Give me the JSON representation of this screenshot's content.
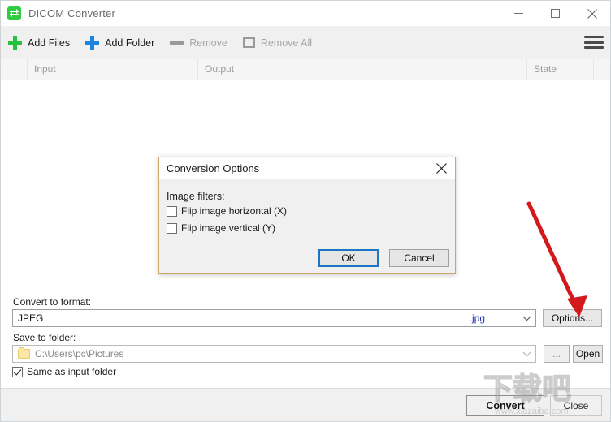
{
  "window": {
    "title": "DICOM Converter",
    "app_icon": "convert-arrows-icon",
    "controls": {
      "minimize": "minimize-icon",
      "maximize": "maximize-icon",
      "close": "close-icon"
    }
  },
  "toolbar": {
    "items": [
      {
        "label": "Add Files",
        "icon": "plus-green-icon",
        "disabled": false
      },
      {
        "label": "Add Folder",
        "icon": "plus-blue-icon",
        "disabled": false
      },
      {
        "label": "Remove",
        "icon": "minus-dash-icon",
        "disabled": true
      },
      {
        "label": "Remove All",
        "icon": "square-icon",
        "disabled": true
      }
    ],
    "menu_icon": "hamburger-menu-icon"
  },
  "file_list": {
    "columns": [
      "Input",
      "Output",
      "State"
    ],
    "rows": []
  },
  "form": {
    "format_label": "Convert to format:",
    "format_value": "JPEG",
    "format_extension": ".jpg",
    "options_button": "Options...",
    "folder_label": "Save to folder:",
    "folder_value": "C:\\Users\\pc\\Pictures",
    "browse_button": "...",
    "open_button": "Open",
    "same_folder_label": "Same as input folder",
    "same_folder_checked": true
  },
  "footer": {
    "convert_button": "Convert",
    "close_button": "Close"
  },
  "dialog": {
    "title": "Conversion Options",
    "section_label": "Image filters:",
    "checkboxes": [
      {
        "label": "Flip image horizontal (X)",
        "checked": false
      },
      {
        "label": "Flip image vertical (Y)",
        "checked": false
      }
    ],
    "ok_button": "OK",
    "cancel_button": "Cancel"
  },
  "annotation": {
    "arrow_color": "#d2191b",
    "arrow_target": "Options..."
  },
  "watermark": {
    "text": "下载吧",
    "url": "www.xiazaiba.com"
  },
  "colors": {
    "accent_green": "#27c23c",
    "accent_blue": "#1a86e0",
    "focus_blue": "#1b74c4",
    "dialog_border": "#c8a96a",
    "toolbar_bg": "#f0f0f0",
    "extension_text": "#2431c0"
  }
}
